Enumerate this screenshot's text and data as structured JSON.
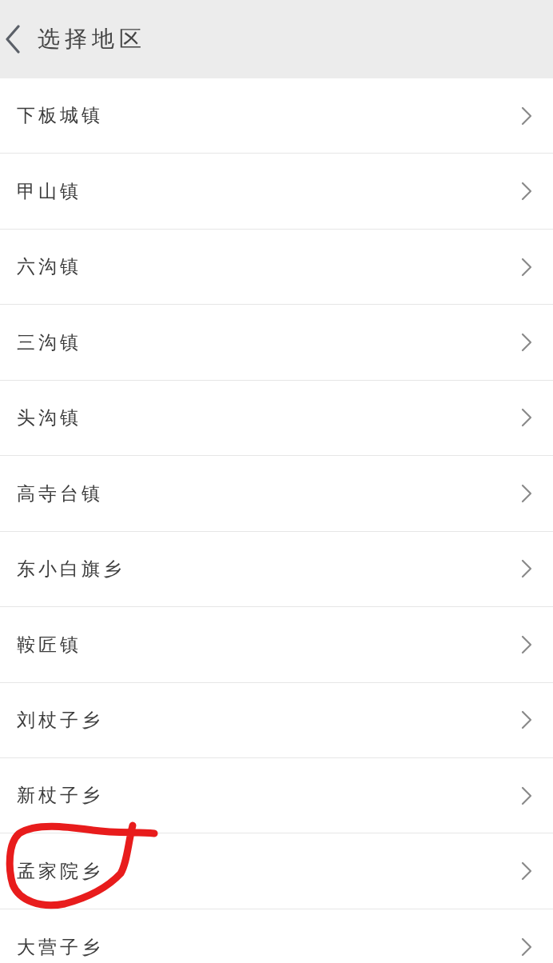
{
  "header": {
    "title": "选择地区"
  },
  "regions": [
    {
      "name": "下板城镇",
      "circled": false
    },
    {
      "name": "甲山镇",
      "circled": false
    },
    {
      "name": "六沟镇",
      "circled": false
    },
    {
      "name": "三沟镇",
      "circled": false
    },
    {
      "name": "头沟镇",
      "circled": false
    },
    {
      "name": "高寺台镇",
      "circled": false
    },
    {
      "name": "东小白旗乡",
      "circled": false
    },
    {
      "name": "鞍匠镇",
      "circled": false
    },
    {
      "name": "刘杖子乡",
      "circled": false
    },
    {
      "name": "新杖子乡",
      "circled": false
    },
    {
      "name": "孟家院乡",
      "circled": true
    },
    {
      "name": "大营子乡",
      "circled": false
    }
  ]
}
